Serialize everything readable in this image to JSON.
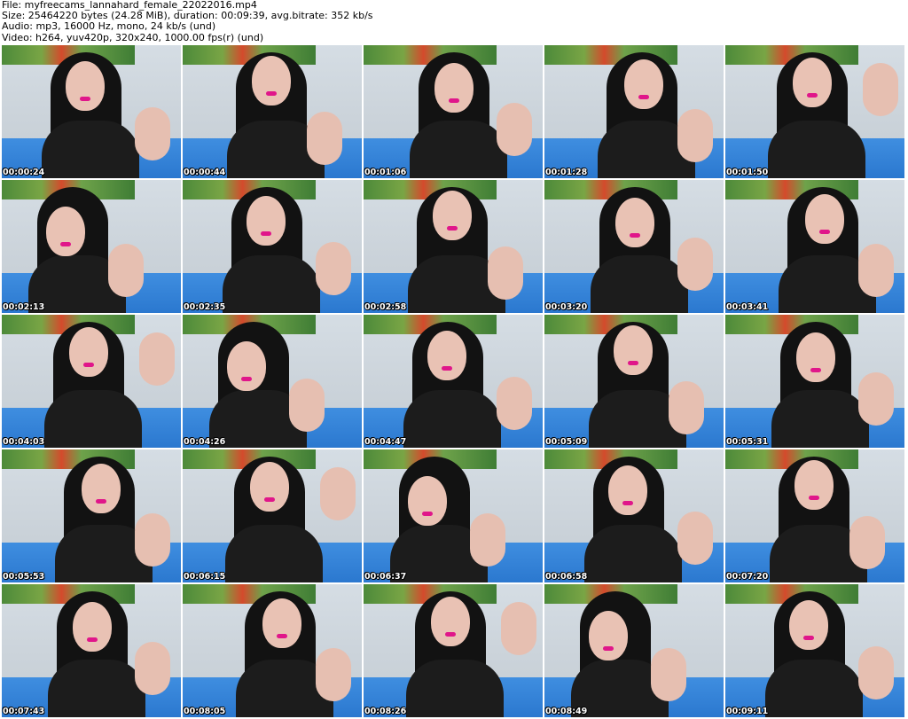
{
  "header": {
    "file_line": "File: myfreecams_lannahard_female_22022016.mp4",
    "size_line": "Size: 25464220 bytes (24.28 MiB), duration: 00:09:39, avg.bitrate: 352 kb/s",
    "audio_line": "Audio: mp3, 16000 Hz, mono, 24 kb/s (und)",
    "video_line": "Video: h264, yuv420p, 320x240, 1000.00 fps(r) (und)"
  },
  "colors": {
    "wall": "#cfd7de",
    "poster_green": "#4d8a3a",
    "sofa_blue": "#2b78cf",
    "hair": "#121212",
    "shirt": "#1c1c1c",
    "lipstick": "#e0168a",
    "skin": "#e9c2b4"
  },
  "thumbnails": [
    {
      "timestamp": "00:00:24"
    },
    {
      "timestamp": "00:00:44"
    },
    {
      "timestamp": "00:01:06"
    },
    {
      "timestamp": "00:01:28"
    },
    {
      "timestamp": "00:01:50"
    },
    {
      "timestamp": "00:02:13"
    },
    {
      "timestamp": "00:02:35"
    },
    {
      "timestamp": "00:02:58"
    },
    {
      "timestamp": "00:03:20"
    },
    {
      "timestamp": "00:03:41"
    },
    {
      "timestamp": "00:04:03"
    },
    {
      "timestamp": "00:04:26"
    },
    {
      "timestamp": "00:04:47"
    },
    {
      "timestamp": "00:05:09"
    },
    {
      "timestamp": "00:05:31"
    },
    {
      "timestamp": "00:05:53"
    },
    {
      "timestamp": "00:06:15"
    },
    {
      "timestamp": "00:06:37"
    },
    {
      "timestamp": "00:06:58"
    },
    {
      "timestamp": "00:07:20"
    },
    {
      "timestamp": "00:07:43"
    },
    {
      "timestamp": "00:08:05"
    },
    {
      "timestamp": "00:08:26"
    },
    {
      "timestamp": "00:08:49"
    },
    {
      "timestamp": "00:09:11"
    }
  ]
}
